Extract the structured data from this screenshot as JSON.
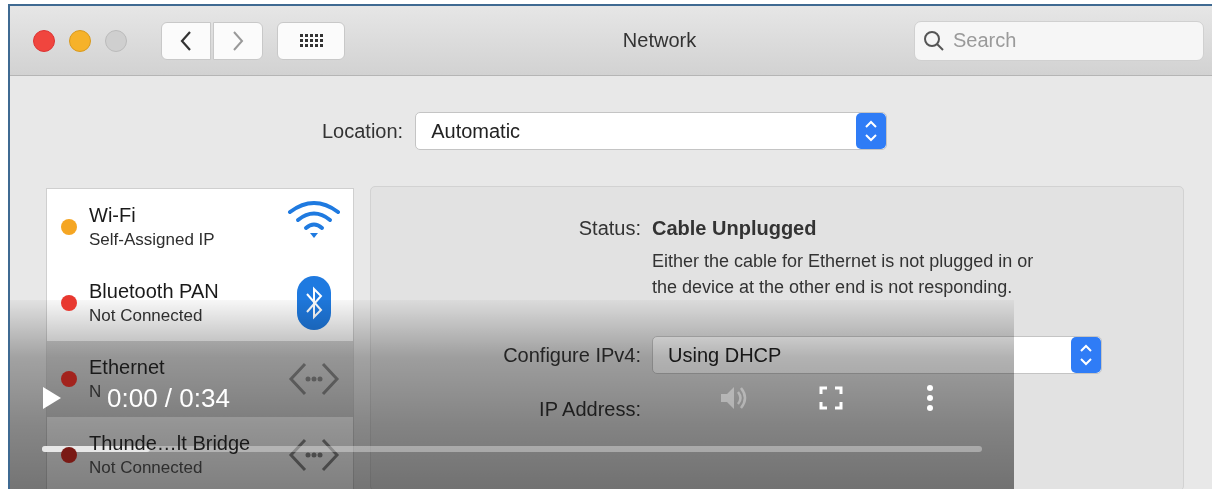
{
  "window": {
    "title": "Network"
  },
  "search": {
    "placeholder": "Search"
  },
  "location": {
    "label": "Location:",
    "value": "Automatic"
  },
  "interfaces": [
    {
      "name": "Wi-Fi",
      "status": "Self-Assigned IP",
      "color": "#f5a623",
      "kind": "wifi",
      "selected": false
    },
    {
      "name": "Bluetooth PAN",
      "status": "Not Connected",
      "color": "#e8382f",
      "kind": "bluetooth",
      "selected": false
    },
    {
      "name": "Ethernet",
      "status": "N",
      "color": "#a3231d",
      "kind": "ethernet",
      "selected": true
    },
    {
      "name": "Thunde…lt Bridge",
      "status": "Not Connected",
      "color": "#7a1a15",
      "kind": "ethernet",
      "selected": false
    }
  ],
  "detail": {
    "status_label": "Status:",
    "status_value": "Cable Unplugged",
    "description": "Either the cable for Ethernet is not plugged in or the device at the other end is not responding.",
    "configure_label": "Configure IPv4:",
    "configure_value": "Using DHCP",
    "ip_label": "IP Address:"
  },
  "video": {
    "playing": false,
    "time": "0:00 / 0:34",
    "progress": {
      "level": 0.115
    }
  }
}
